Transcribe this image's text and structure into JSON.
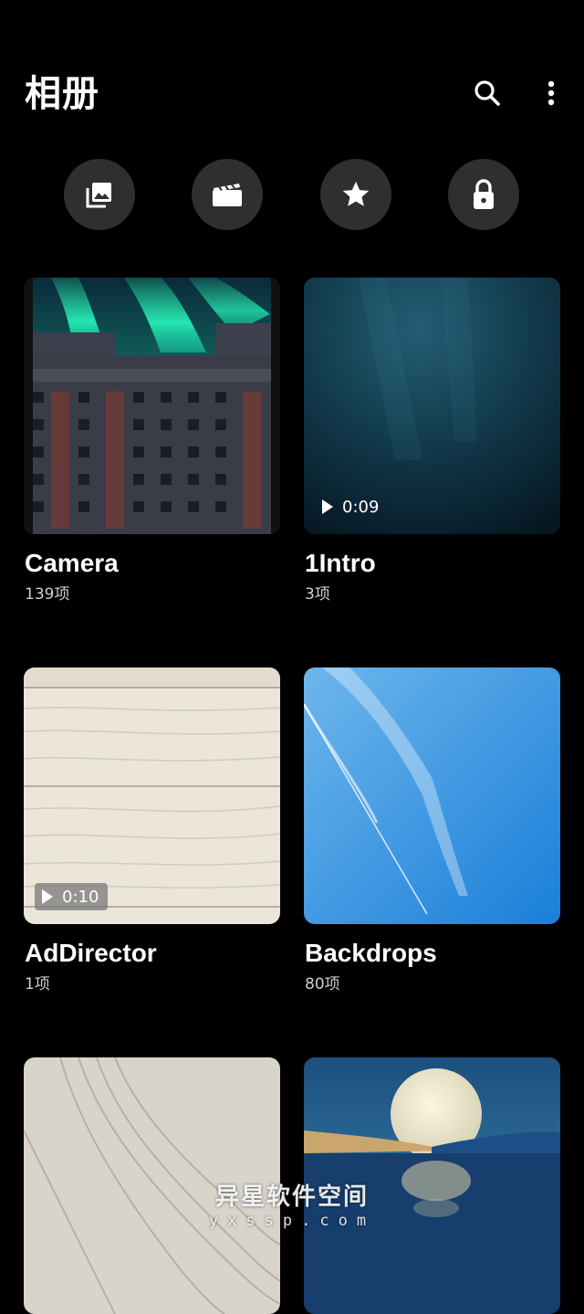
{
  "header": {
    "title": "相册",
    "search_icon": "search-icon",
    "more_icon": "more-vert-icon"
  },
  "quick_actions": [
    {
      "icon": "pictures-icon"
    },
    {
      "icon": "videos-icon"
    },
    {
      "icon": "favorites-star-icon"
    },
    {
      "icon": "locked-lock-icon"
    }
  ],
  "albums": [
    {
      "name": "Camera",
      "count": "139项"
    },
    {
      "name": "1Intro",
      "count": "3项",
      "duration": "0:09"
    },
    {
      "name": "AdDirector",
      "count": "1项",
      "duration": "0:10"
    },
    {
      "name": "Backdrops",
      "count": "80项"
    },
    {
      "name": "",
      "count": ""
    },
    {
      "name": "",
      "count": ""
    }
  ],
  "watermark": {
    "main": "异星软件空间",
    "sub": "yxssp.com"
  },
  "colors": {
    "background": "#000000",
    "button_bg": "#2f2f2f",
    "text": "#ffffff",
    "subtext": "#cfcfcf"
  }
}
